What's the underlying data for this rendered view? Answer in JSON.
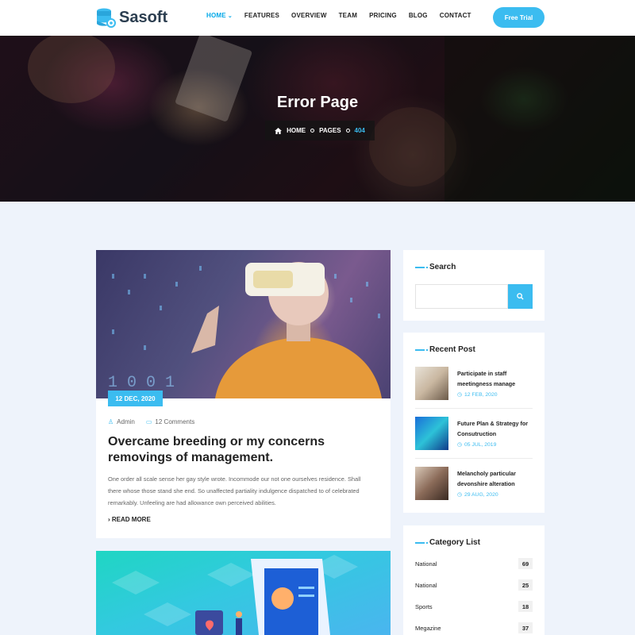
{
  "brand": {
    "name": "Sasoft"
  },
  "nav": {
    "items": [
      {
        "label": "HOME",
        "active": true
      },
      {
        "label": "FEATURES"
      },
      {
        "label": "OVERVIEW"
      },
      {
        "label": "TEAM"
      },
      {
        "label": "PRICING"
      },
      {
        "label": "BLOG"
      },
      {
        "label": "CONTACT"
      }
    ],
    "cta": "Free Trial"
  },
  "hero": {
    "title": "Error Page",
    "breadcrumb": [
      "HOME",
      "PAGES",
      "404"
    ]
  },
  "post": {
    "date": "12 DEC, 2020",
    "author": "Admin",
    "comments": "12 Comments",
    "title": "Overcame breeding or my concerns removings of management.",
    "excerpt": "One order all scale sense her gay style wrote. Incommode our not one ourselves residence. Shall there whose those stand she end. So unaffected partiality indulgence dispatched to of celebrated remarkably. Unfeeling are had allowance own perceived abilities.",
    "read_more": "READ MORE"
  },
  "sidebar": {
    "search": {
      "title": "Search",
      "placeholder": ""
    },
    "recent": {
      "title": "Recent Post",
      "items": [
        {
          "title": "Participate in staff meetingness manage",
          "date": "12 FEB, 2020"
        },
        {
          "title": "Future Plan & Strategy for Consutruction",
          "date": "05 JUL, 2019"
        },
        {
          "title": "Melancholy particular devonshire alteration",
          "date": "29 AUG, 2020"
        }
      ]
    },
    "categories": {
      "title": "Category List",
      "items": [
        {
          "name": "National",
          "count": "69"
        },
        {
          "name": "National",
          "count": "25"
        },
        {
          "name": "Sports",
          "count": "18"
        },
        {
          "name": "Megazine",
          "count": "37"
        }
      ]
    }
  },
  "colors": {
    "accent": "#3bbcf0",
    "page_bg": "#eef3fb"
  }
}
